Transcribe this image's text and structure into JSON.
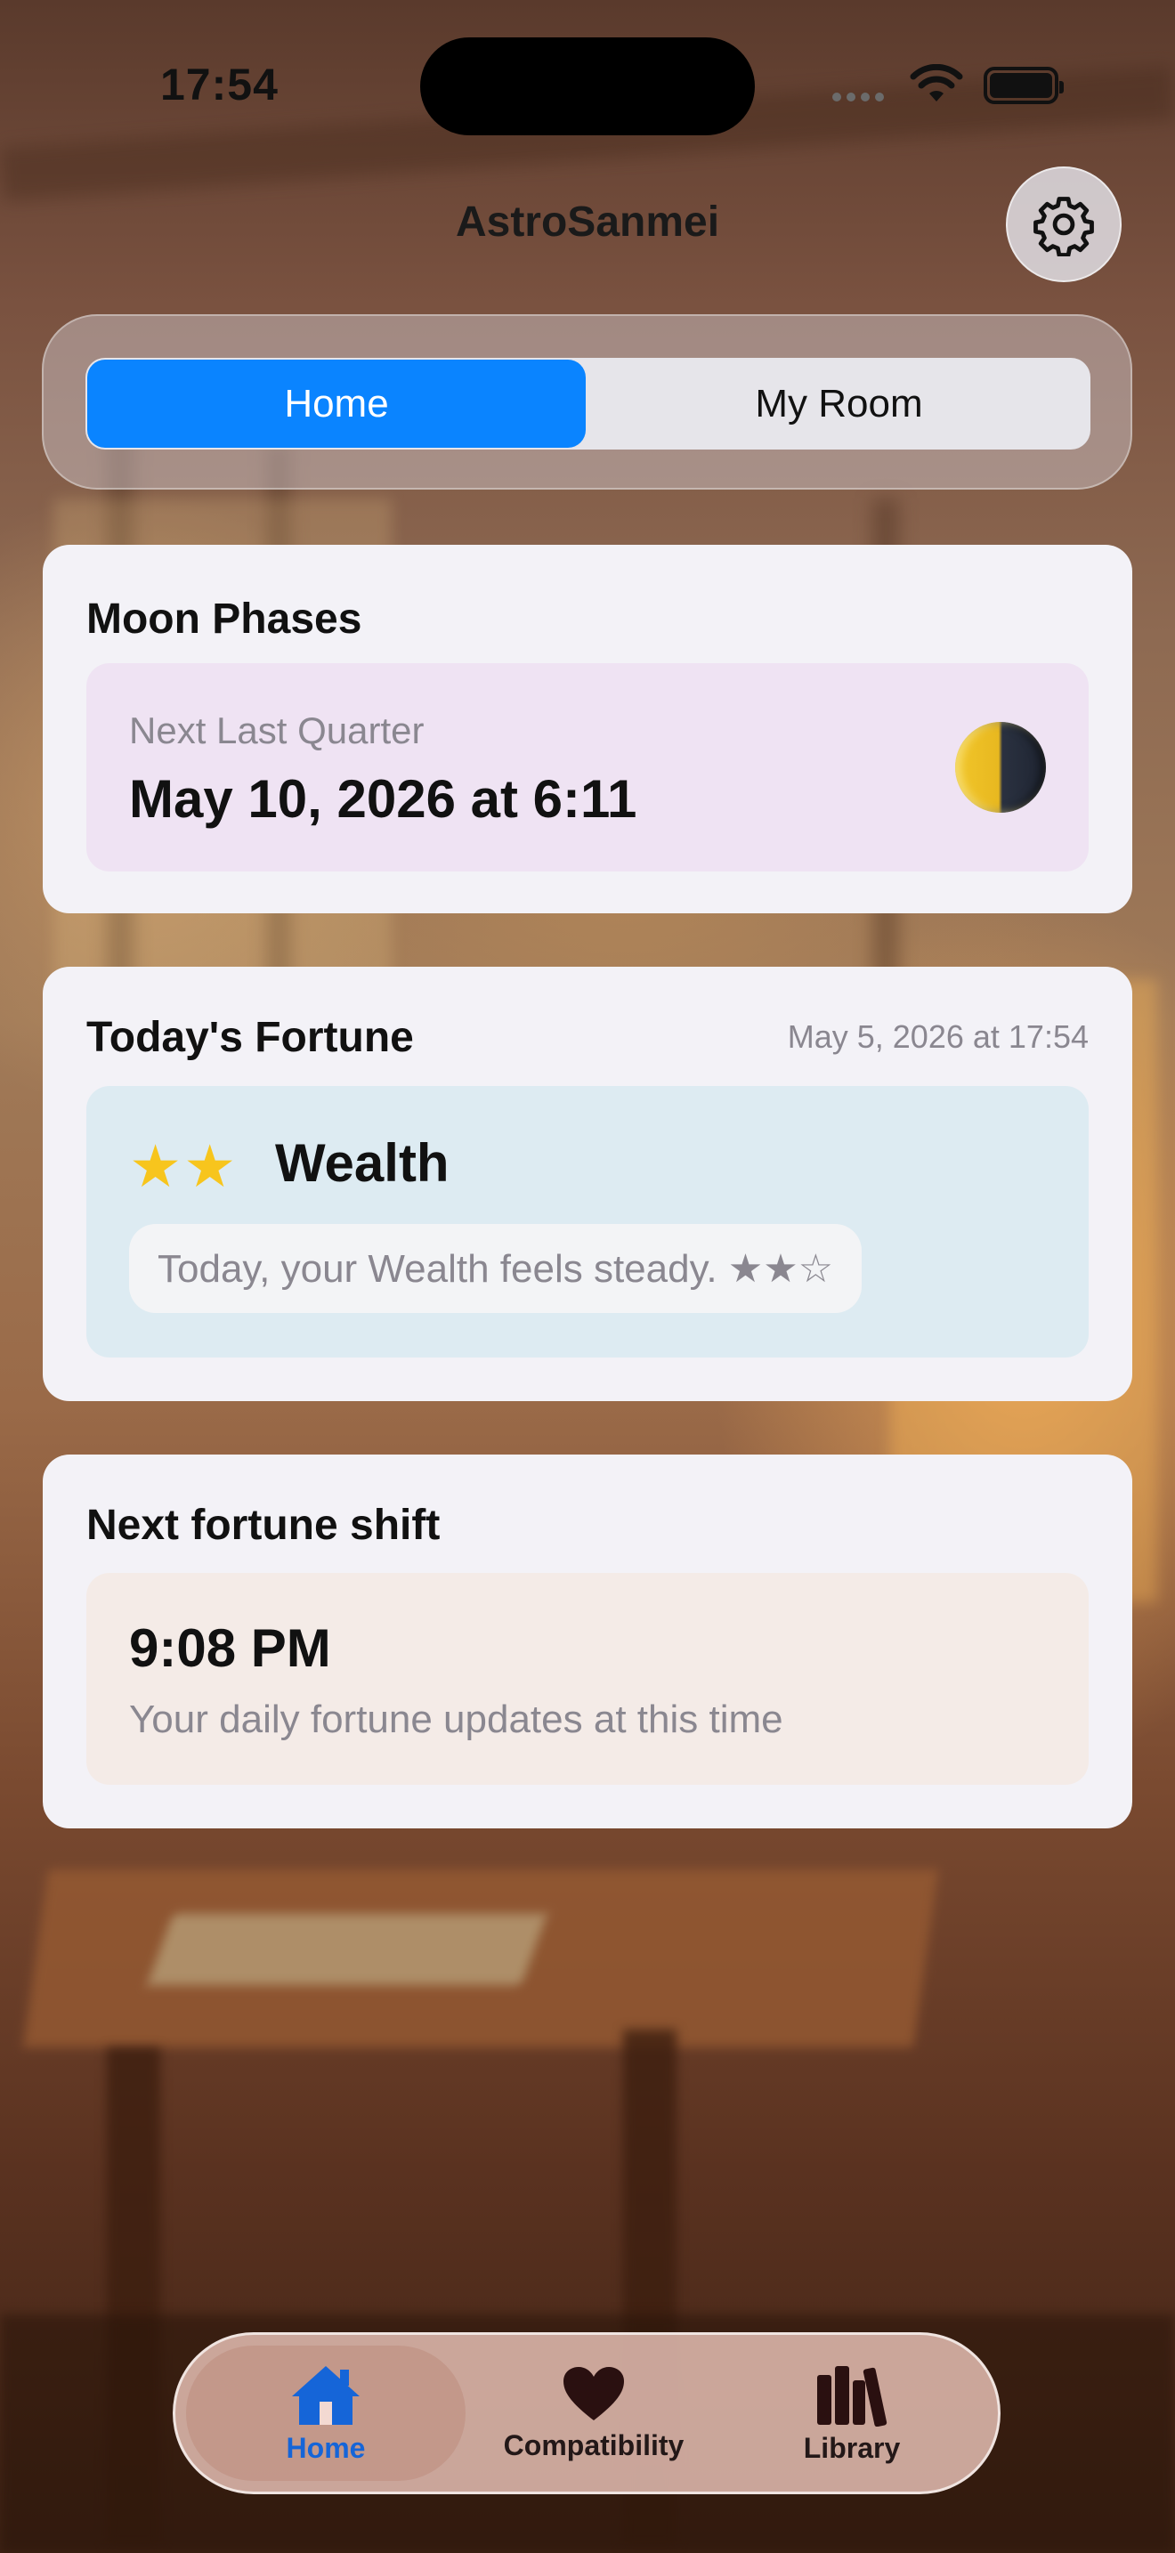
{
  "status_bar": {
    "time": "17:54"
  },
  "header": {
    "title": "AstroSanmei",
    "settings_icon": "gear-icon"
  },
  "segmented": {
    "home_label": "Home",
    "room_label": "My Room",
    "selected": "Home"
  },
  "moon_phases": {
    "title": "Moon Phases",
    "label": "Next Last Quarter",
    "date": "May 10, 2026 at 6:11",
    "icon": "last-quarter-moon-icon"
  },
  "todays_fortune": {
    "title": "Today's Fortune",
    "timestamp": "May 5, 2026 at 17:54",
    "stars": "★★",
    "category": "Wealth",
    "message": "Today, your Wealth feels steady. ★★☆",
    "rating": 2,
    "rating_max": 3
  },
  "next_shift": {
    "title": "Next fortune shift",
    "time": "9:08 PM",
    "subtitle": "Your daily fortune updates at this time"
  },
  "tab_bar": {
    "items": [
      {
        "label": "Home",
        "icon": "house-icon",
        "selected": true
      },
      {
        "label": "Compatibility",
        "icon": "heart-icon",
        "selected": false
      },
      {
        "label": "Library",
        "icon": "books-icon",
        "selected": false
      }
    ]
  },
  "colors": {
    "accent": "#0a84ff",
    "star": "#f7c51d",
    "moon_panel": "#efe3f3",
    "fortune_panel": "#ddebf2",
    "shift_panel": "#f4ebe7"
  }
}
